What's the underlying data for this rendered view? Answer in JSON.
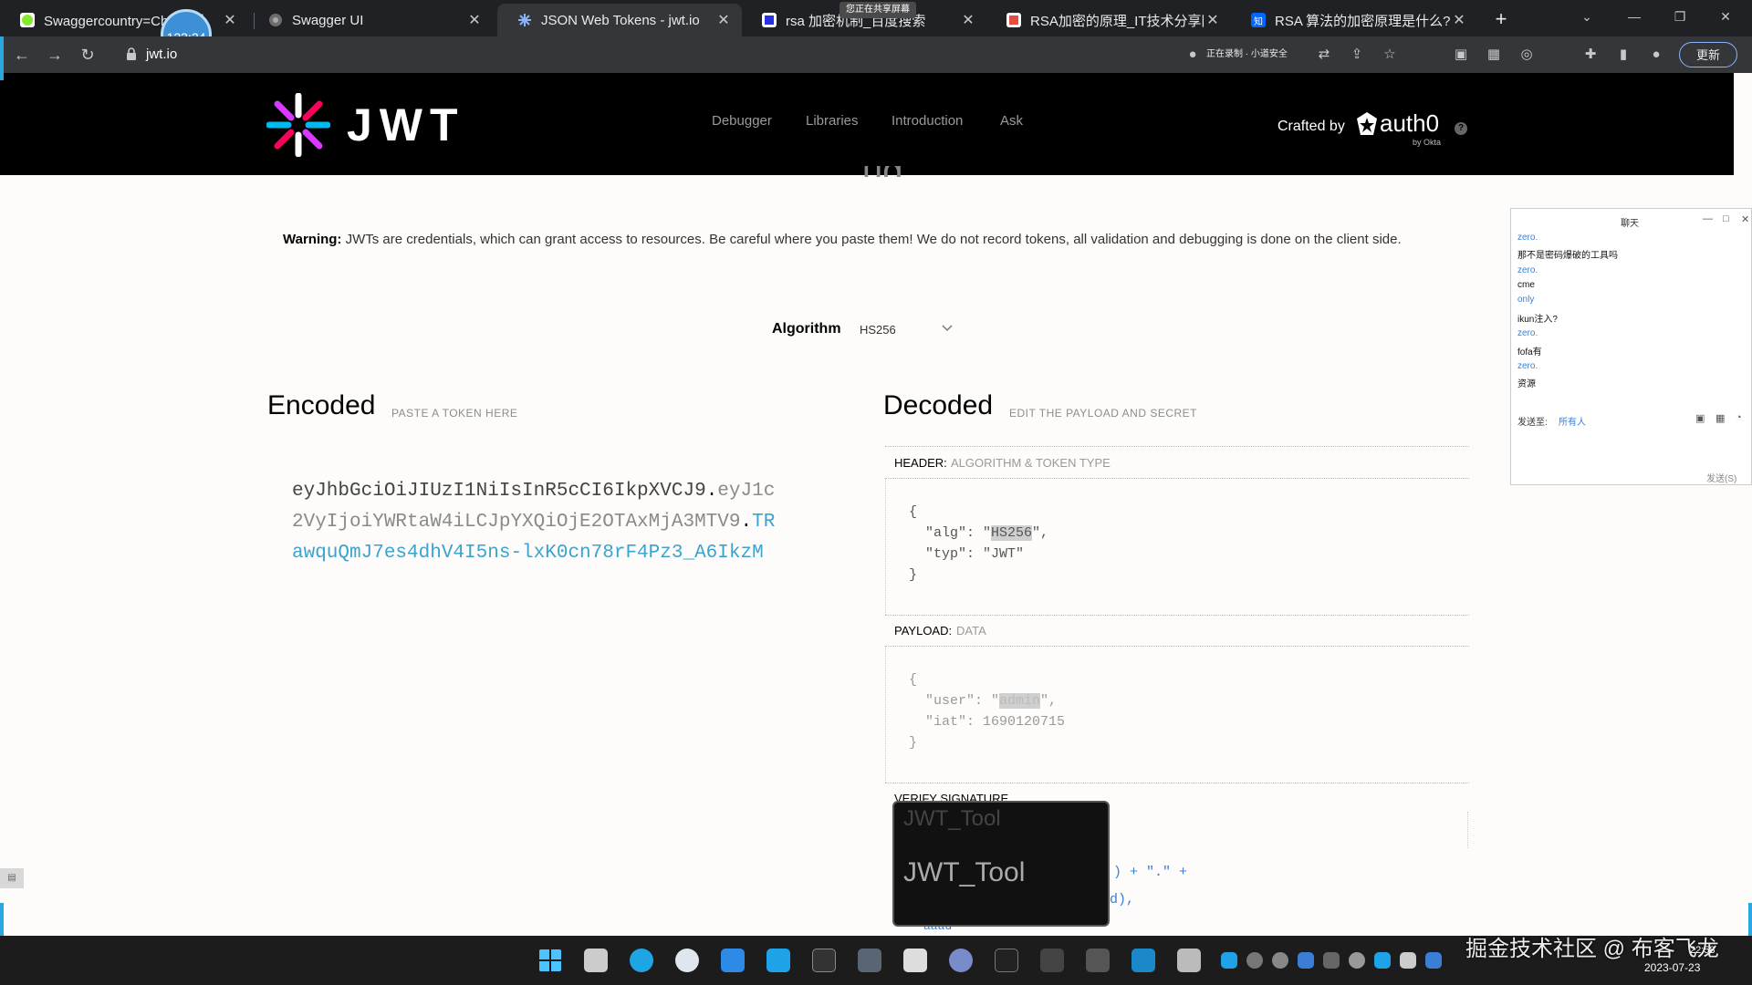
{
  "browser": {
    "tabs": [
      {
        "title": "Swaggercountry=Ch...统计",
        "favicon": "swagger-icon",
        "color": "#85ea2d"
      },
      {
        "title": "Swagger UI",
        "favicon": "swagger-icon",
        "color": "#85ea2d"
      },
      {
        "title": "JSON Web Tokens - jwt.io",
        "favicon": "jwt-icon",
        "color": "#fb015b",
        "active": true
      },
      {
        "title": "rsa 加密机制_百度搜索",
        "favicon": "baidu-icon",
        "color": "#2932e1"
      },
      {
        "title": "RSA加密的原理_IT技术分享网",
        "favicon": "site-icon",
        "color": "#e74c3c"
      },
      {
        "title": "RSA 算法的加密原理是什么? - 知乎",
        "favicon": "zhihu-icon",
        "color": "#0066ff"
      }
    ],
    "timer": "123:24",
    "sharing_badge": "您正在共享屏幕",
    "url": "jwt.io",
    "recording_text": "正在录制 · 小道安全",
    "update_label": "更新"
  },
  "site": {
    "logo_text": "JWT",
    "nav": [
      "Debugger",
      "Libraries",
      "Introduction",
      "Ask"
    ],
    "crafted_by": "Crafted by",
    "auth0": "auth0",
    "by_okta": "by Okta"
  },
  "warning": {
    "label": "Warning:",
    "text": " JWTs are credentials, which can grant access to resources. Be careful where you paste them! We do not record tokens, all validation and debugging is done on the client side."
  },
  "algorithm": {
    "label": "Algorithm",
    "value": "HS256"
  },
  "encoded": {
    "title": "Encoded",
    "subtitle": "PASTE A TOKEN HERE",
    "header_part": "eyJhbGciOiJIUzI1NiIsInR5cCI6IkpXVCJ9",
    "payload_part": "eyJ1c2VyIjoiYWRtaW4iLCJpYXQiOjE2OTAxMjA3MTV9",
    "signature_part": "TRawquQmJ7es4dhV4I5ns-lxK0cn78rF4Pz3_A6IkzM"
  },
  "decoded": {
    "title": "Decoded",
    "subtitle": "EDIT THE PAYLOAD AND SECRET",
    "header_label": "HEADER:",
    "header_sub": "ALGORITHM & TOKEN TYPE",
    "header_json": {
      "alg": "HS256",
      "typ": "JWT"
    },
    "payload_label": "PAYLOAD:",
    "payload_sub": "DATA",
    "payload_json": {
      "user": "admin",
      "iat": "1690120715"
    },
    "verify_label": "VERIFY SIGNATURE",
    "verify_frag1": ") + \".\" +",
    "verify_frag2": "d),",
    "verify_frag3": "aaad"
  },
  "tooltip": {
    "text": "JWT_Tool",
    "ghost": "JWT_Tool"
  },
  "chat": {
    "title": "聊天",
    "messages": [
      {
        "name": "zero.",
        "text": "那不是密码爆破的工具吗"
      },
      {
        "name": "zero.",
        "text": "cme"
      },
      {
        "name": "only",
        "text": "ikun注入?"
      },
      {
        "name": "zero.",
        "text": "fofa有"
      },
      {
        "name": "zero.",
        "text": "资源"
      }
    ],
    "send_to_label": "发送至:",
    "send_to_target": "所有人",
    "send_button": "发送(S)"
  },
  "taskbar": {
    "watermark": "掘金技术社区 @ 布客飞龙",
    "time": "22:58",
    "date": "2023-07-23"
  },
  "colors": {
    "jwt_header": "#fb015b",
    "jwt_payload": "#d63aff",
    "jwt_signature": "#00b9f1",
    "site_header_bg": "#000000"
  }
}
